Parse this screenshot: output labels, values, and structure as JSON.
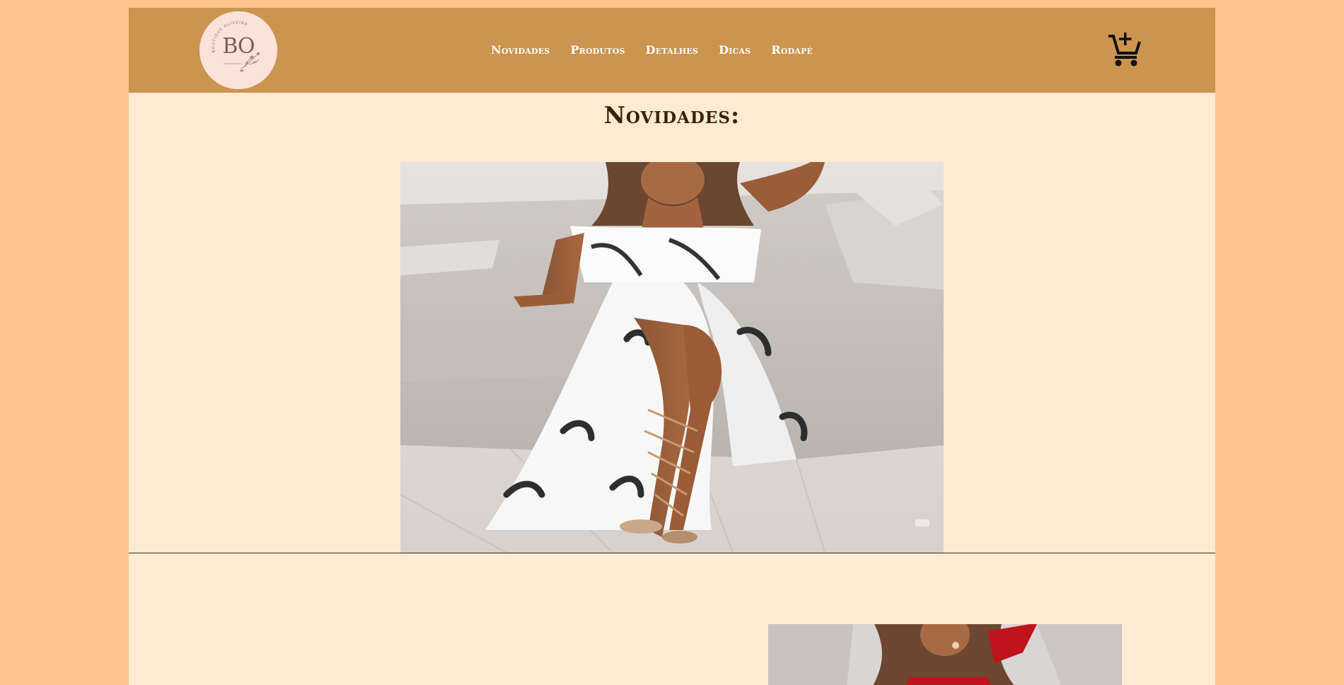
{
  "brand": {
    "monogram": "BO",
    "arc_text": "BOUTIQUE OLIVEIRA"
  },
  "nav": {
    "items": [
      {
        "label": "Novidades"
      },
      {
        "label": "Produtos"
      },
      {
        "label": "Detalhes"
      },
      {
        "label": "Dicas"
      },
      {
        "label": "Rodapé"
      }
    ]
  },
  "cart": {
    "icon": "add-shopping-cart-icon"
  },
  "section": {
    "title": "Novidades:"
  },
  "colors": {
    "outer_background": "#fec48f",
    "content_background": "#ffebd2",
    "header_background": "#cb944f",
    "title_color": "#3a2207",
    "nav_text": "#ffffff",
    "logo_background": "#fbe2da"
  },
  "images": {
    "hero": "woman in white off-shoulder top and leaf-print slit skirt on sofa",
    "second": "woman in red outfit on sofa"
  }
}
